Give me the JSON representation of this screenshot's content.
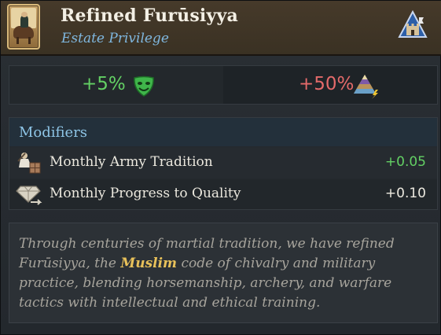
{
  "header": {
    "title": "Refined Furūsiyya",
    "subtitle": "Estate Privilege"
  },
  "stats": {
    "left_value": "+5%",
    "left_icon": "mask-icon",
    "right_value": "+50%",
    "right_icon": "pyramid-icon"
  },
  "modifiers": {
    "title": "Modifiers",
    "items": [
      {
        "label": "Monthly Army Tradition",
        "value": "+0.05",
        "icon": "army-tradition-icon",
        "color": "#63d064"
      },
      {
        "label": "Monthly Progress to Quality",
        "value": "+0.10",
        "icon": "quality-icon",
        "color": "#ece9df"
      }
    ]
  },
  "description": {
    "before": "Through centuries of martial tradition, we have refined Furūsiyya, the ",
    "keyword": "Muslim",
    "after": " code of chivalry and military practice, blending horsemanship, archery, and warfare tactics with intellectual and ethical training."
  },
  "colors": {
    "positive": "#63d064",
    "negative": "#e46a6a",
    "subtitle": "#7fb7df",
    "keyword": "#e8c15a"
  }
}
